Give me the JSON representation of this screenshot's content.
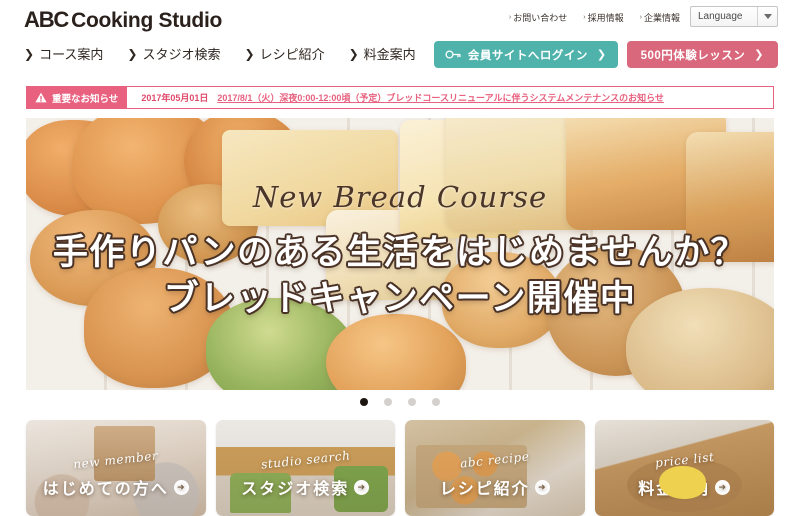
{
  "site": {
    "logo_abc": "ABC",
    "logo_rest": "Cooking Studio"
  },
  "header": {
    "util_links": [
      {
        "label": "お問い合わせ",
        "chev": "›"
      },
      {
        "label": "採用情報",
        "chev": "›"
      },
      {
        "label": "企業情報",
        "chev": "›"
      }
    ],
    "language_select": {
      "value": "Language",
      "icon": "chevron-down-icon"
    },
    "nav": [
      {
        "label": "コース案内",
        "chev": "❯"
      },
      {
        "label": "スタジオ検索",
        "chev": "❯"
      },
      {
        "label": "レシピ紹介",
        "chev": "❯"
      },
      {
        "label": "料金案内",
        "chev": "❯"
      }
    ],
    "login_button": {
      "label": "会員サイトへログイン",
      "tail": "❯",
      "icon": "key-icon",
      "color": "#4fb3ac"
    },
    "trial_button": {
      "label": "500円体験レッスン",
      "tail": "❯",
      "color": "#d9687c"
    }
  },
  "notice": {
    "badge_label": "重要なお知らせ",
    "badge_icon": "warning-triangle-icon",
    "date": "2017年05月01日",
    "link_text": "2017/8/1（火）深夜0:00-12:00頃（予定）ブレッドコースリニューアルに伴うシステムメンテナンスのお知らせ",
    "color": "#e8617f"
  },
  "hero": {
    "script_title": "New Bread Course",
    "headline_line1": "手作りパンのある生活をはじめませんか？",
    "headline_line2": "ブレッドキャンペーン開催中",
    "dots": [
      {
        "active": true
      },
      {
        "active": false
      },
      {
        "active": false
      },
      {
        "active": false
      }
    ]
  },
  "cards": [
    {
      "en": "new member",
      "jp": "はじめての方へ",
      "arrow": "➜"
    },
    {
      "en": "studio search",
      "jp": "スタジオ検索",
      "arrow": "➜"
    },
    {
      "en": "abc recipe",
      "jp": "レシピ紹介",
      "arrow": "➜"
    },
    {
      "en": "price list",
      "jp": "料金案内",
      "arrow": "➜"
    }
  ]
}
